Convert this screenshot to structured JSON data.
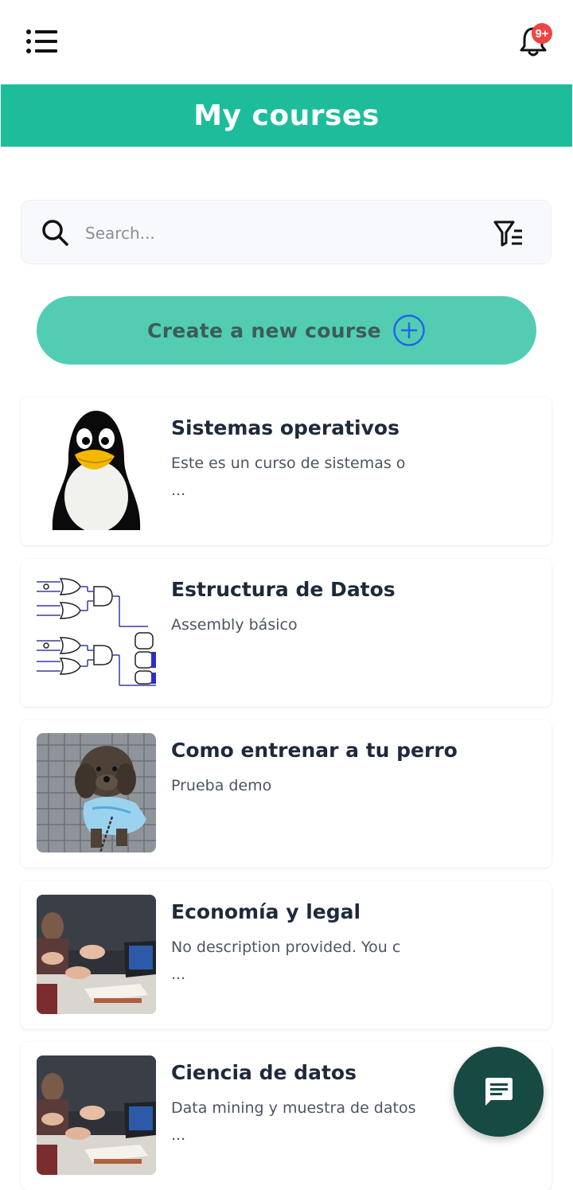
{
  "header": {
    "notification_badge": "9+",
    "badge_color": "#ef4444"
  },
  "banner": {
    "title": "My courses",
    "color": "#1dbd9b"
  },
  "search": {
    "placeholder": "Search..."
  },
  "create_button": {
    "label": "Create a new course",
    "color": "#52cdb2",
    "icon_color": "#2563eb"
  },
  "courses": [
    {
      "title": "Sistemas operativos",
      "description": "Este es un curso de sistemas o",
      "more": "...",
      "thumbnail": "linux-penguin"
    },
    {
      "title": "Estructura de Datos",
      "description": "Assembly básico",
      "more": "",
      "thumbnail": "logic-gates-diagram"
    },
    {
      "title": "Como entrenar a tu perro",
      "description": "Prueba demo",
      "more": "",
      "thumbnail": "dog-photo"
    },
    {
      "title": "Economía y legal",
      "description": "No description provided. You c",
      "more": "...",
      "thumbnail": "meeting-photo"
    },
    {
      "title": "Ciencia de datos",
      "description": "Data mining y muestra de datos",
      "more": "...",
      "thumbnail": "meeting-photo"
    }
  ],
  "fab": {
    "icon": "chat-icon",
    "color": "#174a43"
  }
}
